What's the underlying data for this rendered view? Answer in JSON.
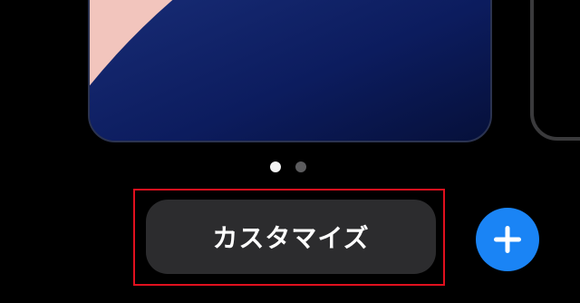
{
  "wallpaper": {
    "colors": {
      "dark_blue": "#0a1a5a",
      "navy": "#081240",
      "pink": "#f2c5bd",
      "border": "#2b3350"
    }
  },
  "page_indicator": {
    "pages": 2,
    "current": 1
  },
  "actions": {
    "customize_label": "カスタマイズ",
    "add_icon": "plus-icon"
  },
  "colors": {
    "background": "#000000",
    "button_bg": "#2c2c2e",
    "accent": "#1a84f5",
    "highlight": "#e0101e"
  }
}
